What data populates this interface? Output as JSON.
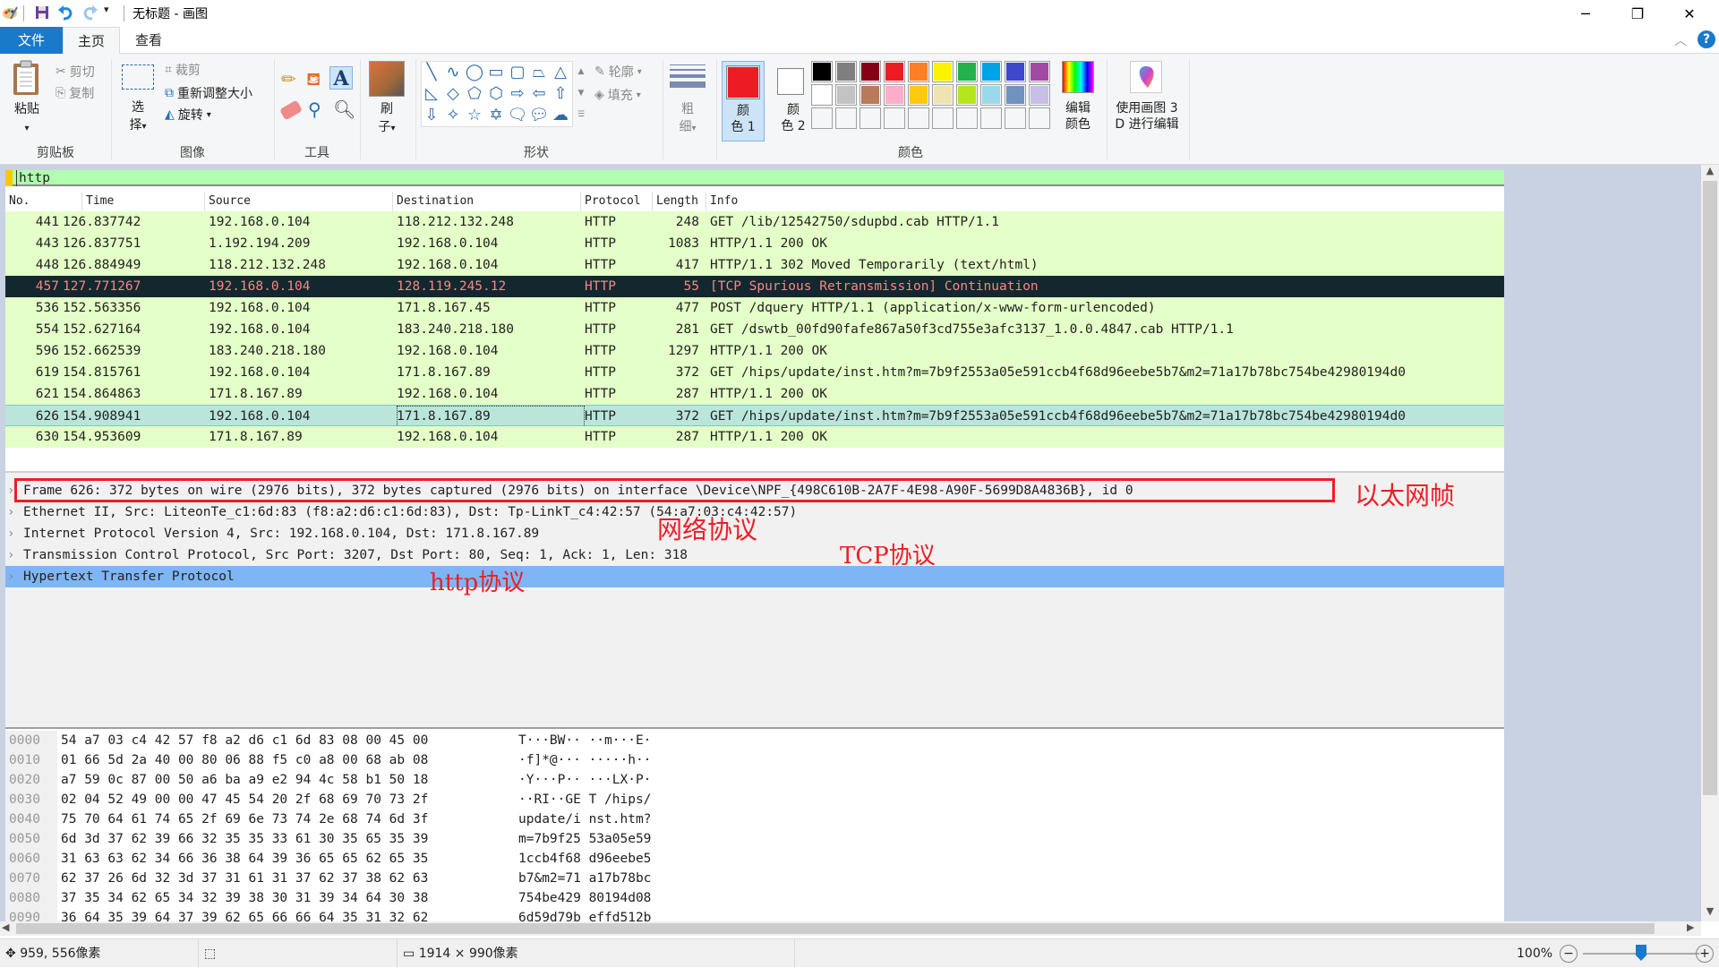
{
  "window": {
    "title": "无标题 - 画图",
    "minimize_icon": "minimize-icon",
    "restore_icon": "restore-icon",
    "close_icon": "close-icon"
  },
  "quick_access": [
    "paint-app-icon",
    "save-icon",
    "undo-icon",
    "redo-icon",
    "customize-dropdown-icon"
  ],
  "tabs": [
    {
      "label": "文件"
    },
    {
      "label": "主页"
    },
    {
      "label": "查看"
    }
  ],
  "ribbon": {
    "clipboard": {
      "label": "剪贴板",
      "paste": "粘贴",
      "cut": "剪切",
      "copy": "复制"
    },
    "image": {
      "label": "图像",
      "select": "选择",
      "crop": "裁剪",
      "resize": "重新调整大小",
      "rotate": "旋转"
    },
    "tools": {
      "label": "工具"
    },
    "brushes": {
      "label": "刷子"
    },
    "shapes": {
      "label": "形状",
      "outline": "轮廓",
      "fill": "填充"
    },
    "size": {
      "label": "粗细"
    },
    "colors": {
      "label": "颜色",
      "color1_label": "颜色 1",
      "color2_label": "颜色 2",
      "color1": "#ed1c24",
      "color2": "#ffffff",
      "palette_row1": [
        "#000000",
        "#7f7f7f",
        "#880015",
        "#ed1c24",
        "#ff7f27",
        "#fff200",
        "#22b14c",
        "#00a2e8",
        "#3f48cc",
        "#a349a4"
      ],
      "palette_row2": [
        "#ffffff",
        "#c3c3c3",
        "#b97a57",
        "#ffaec9",
        "#ffc90e",
        "#efe4b0",
        "#b5e61d",
        "#99d9ea",
        "#7092be",
        "#c8bfe7"
      ],
      "edit_colors": "编辑颜色"
    },
    "paint3d": "使用画图 3D 进行编辑"
  },
  "wireshark": {
    "filter": "http",
    "columns": [
      "No.",
      "Time",
      "Source",
      "Destination",
      "Protocol",
      "Length",
      "Info"
    ],
    "packets": [
      {
        "no": "441",
        "time": "126.837742",
        "src": "192.168.0.104",
        "dst": "118.212.132.248",
        "proto": "HTTP",
        "len": "248",
        "info": "GET /lib/12542750/sdupbd.cab HTTP/1.1"
      },
      {
        "no": "443",
        "time": "126.837751",
        "src": "1.192.194.209",
        "dst": "192.168.0.104",
        "proto": "HTTP",
        "len": "1083",
        "info": "HTTP/1.1 200 OK"
      },
      {
        "no": "448",
        "time": "126.884949",
        "src": "118.212.132.248",
        "dst": "192.168.0.104",
        "proto": "HTTP",
        "len": "417",
        "info": "HTTP/1.1 302 Moved Temporarily  (text/html)"
      },
      {
        "no": "457",
        "time": "127.771267",
        "src": "192.168.0.104",
        "dst": "128.119.245.12",
        "proto": "HTTP",
        "len": "55",
        "info": "[TCP Spurious Retransmission] Continuation"
      },
      {
        "no": "536",
        "time": "152.563356",
        "src": "192.168.0.104",
        "dst": "171.8.167.45",
        "proto": "HTTP",
        "len": "477",
        "info": "POST /dquery HTTP/1.1  (application/x-www-form-urlencoded)"
      },
      {
        "no": "554",
        "time": "152.627164",
        "src": "192.168.0.104",
        "dst": "183.240.218.180",
        "proto": "HTTP",
        "len": "281",
        "info": "GET /dswtb_00fd90fafe867a50f3cd755e3afc3137_1.0.0.4847.cab HTTP/1.1"
      },
      {
        "no": "596",
        "time": "152.662539",
        "src": "183.240.218.180",
        "dst": "192.168.0.104",
        "proto": "HTTP",
        "len": "1297",
        "info": "HTTP/1.1 200 OK"
      },
      {
        "no": "619",
        "time": "154.815761",
        "src": "192.168.0.104",
        "dst": "171.8.167.89",
        "proto": "HTTP",
        "len": "372",
        "info": "GET /hips/update/inst.htm?m=7b9f2553a05e591ccb4f68d96eebe5b7&m2=71a17b78bc754be42980194d0"
      },
      {
        "no": "621",
        "time": "154.864863",
        "src": "171.8.167.89",
        "dst": "192.168.0.104",
        "proto": "HTTP",
        "len": "287",
        "info": "HTTP/1.1 200 OK"
      },
      {
        "no": "626",
        "time": "154.908941",
        "src": "192.168.0.104",
        "dst": "171.8.167.89",
        "proto": "HTTP",
        "len": "372",
        "info": "GET /hips/update/inst.htm?m=7b9f2553a05e591ccb4f68d96eebe5b7&m2=71a17b78bc754be42980194d0"
      },
      {
        "no": "630",
        "time": "154.953609",
        "src": "171.8.167.89",
        "dst": "192.168.0.104",
        "proto": "HTTP",
        "len": "287",
        "info": "HTTP/1.1 200 OK"
      }
    ],
    "details": [
      "Frame 626: 372 bytes on wire (2976 bits), 372 bytes captured (2976 bits) on interface \\Device\\NPF_{498C610B-2A7F-4E98-A90F-5699D8A4836B}, id 0",
      "Ethernet II, Src: LiteonTe_c1:6d:83 (f8:a2:d6:c1:6d:83), Dst: Tp-LinkT_c4:42:57 (54:a7:03:c4:42:57)",
      "Internet Protocol Version 4, Src: 192.168.0.104, Dst: 171.8.167.89",
      "Transmission Control Protocol, Src Port: 3207, Dst Port: 80, Seq: 1, Ack: 1, Len: 318",
      "Hypertext Transfer Protocol"
    ],
    "annotations": {
      "ethernet_frame": "以太网帧",
      "network": "网络协议",
      "tcp": "TCP协议",
      "http": "http协议"
    },
    "hex": [
      {
        "off": "0000",
        "bytes": "54 a7 03 c4 42 57 f8 a2  d6 c1 6d 83 08 00 45 00",
        "ascii": "T···BW·· ··m···E·"
      },
      {
        "off": "0010",
        "bytes": "01 66 5d 2a 40 00 80 06  88 f5 c0 a8 00 68 ab 08",
        "ascii": "·f]*@··· ·····h··"
      },
      {
        "off": "0020",
        "bytes": "a7 59 0c 87 00 50 a6 ba  a9 e2 94 4c 58 b1 50 18",
        "ascii": "·Y···P·· ···LX·P·"
      },
      {
        "off": "0030",
        "bytes": "02 04 52 49 00 00 47 45  54 20 2f 68 69 70 73 2f",
        "ascii": "··RI··GE T /hips/"
      },
      {
        "off": "0040",
        "bytes": "75 70 64 61 74 65 2f 69  6e 73 74 2e 68 74 6d 3f",
        "ascii": "update/i nst.htm?"
      },
      {
        "off": "0050",
        "bytes": "6d 3d 37 62 39 66 32 35  35 33 61 30 35 65 35 39",
        "ascii": "m=7b9f25 53a05e59"
      },
      {
        "off": "0060",
        "bytes": "31 63 63 62 34 66 36 38  64 39 36 65 65 62 65 35",
        "ascii": "1ccb4f68 d96eebe5"
      },
      {
        "off": "0070",
        "bytes": "62 37 26 6d 32 3d 37 31  61 31 37 62 37 38 62 63",
        "ascii": "b7&m2=71 a17b78bc"
      },
      {
        "off": "0080",
        "bytes": "37 35 34 62 65 34 32 39  38 30 31 39 34 64 30 38",
        "ascii": "754be429 80194d08"
      },
      {
        "off": "0090",
        "bytes": "36 64 35 39 64 37 39 62  65 66 66 64 35 31 32 62",
        "ascii": "6d59d79b effd512b"
      }
    ]
  },
  "status": {
    "cursor_pos": "959, 556像素",
    "selection_size": "",
    "canvas_size": "1914 × 990像素",
    "zoom": "100%",
    "zoom_level_percent": 100
  }
}
